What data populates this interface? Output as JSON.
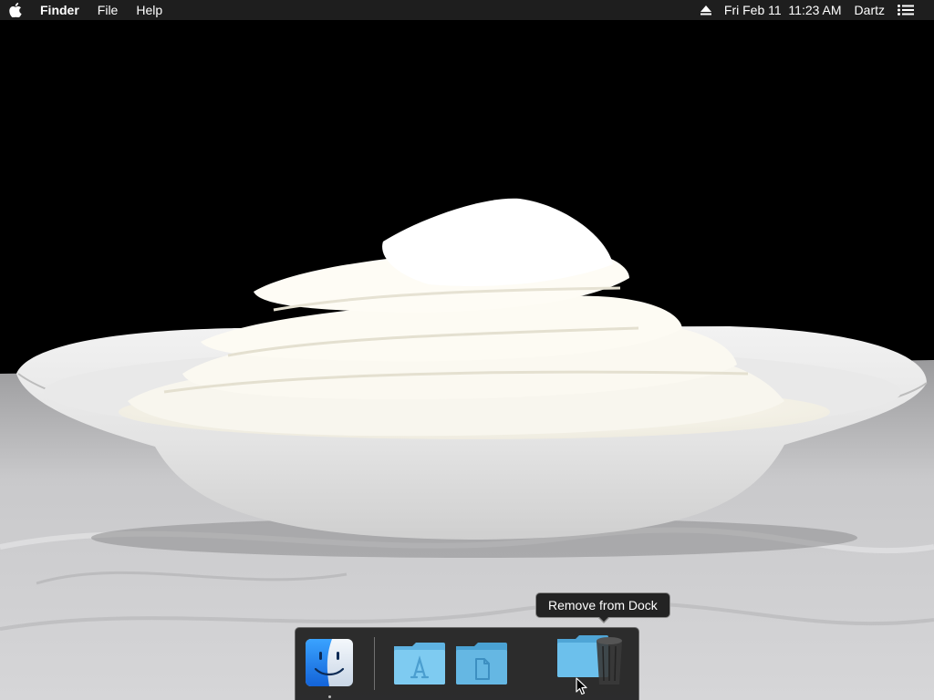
{
  "menubar": {
    "apple_icon": "apple-logo-icon",
    "app_name": "Finder",
    "menus": [
      "File",
      "Help"
    ],
    "eject_icon": "eject-icon",
    "datetime": "Fri Feb 11  11:23 AM",
    "user": "Dartz",
    "notification_icon": "list-bullets-icon"
  },
  "wallpaper": {
    "description_icon": "whipped-cream-wallpaper"
  },
  "dock": {
    "apps": [
      {
        "name": "Finder",
        "icon": "finder-icon",
        "running": true
      },
      {
        "name": "Applications",
        "icon": "applications-folder-icon",
        "running": false
      },
      {
        "name": "Documents",
        "icon": "documents-folder-icon",
        "running": false
      },
      {
        "name": "Folder",
        "icon": "folder-icon",
        "running": false
      },
      {
        "name": "Trash",
        "icon": "trash-icon",
        "running": false
      }
    ]
  },
  "tooltip": {
    "text": "Remove from Dock"
  },
  "colors": {
    "menubar_bg": "#1e1e1e",
    "folder_blue": "#6cc0ec",
    "finder_blue": "#1e90ff"
  }
}
